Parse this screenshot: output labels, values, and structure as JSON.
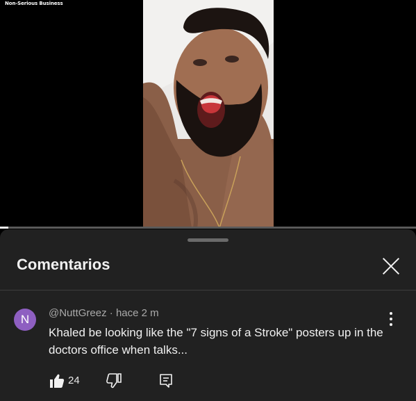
{
  "video": {
    "watermark": "Non-Serious Business",
    "progress_fraction": 0.02
  },
  "comments_panel": {
    "title": "Comentarios",
    "close_icon": "close-icon"
  },
  "comment": {
    "avatar_letter": "N",
    "avatar_color": "#8e5fc1",
    "author": "@NuttGreez",
    "time": "hace 2 m",
    "text": "Khaled be looking like the \"7 signs of a Stroke\" posters up in the doctors office when talks...",
    "likes": "24"
  },
  "colors": {
    "sheet_background": "#212121",
    "text_primary": "#f1f1f1",
    "text_secondary": "#aaaaaa"
  }
}
